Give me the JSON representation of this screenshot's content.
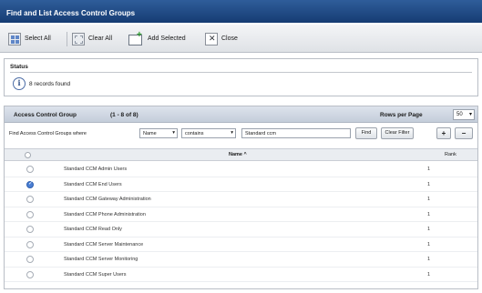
{
  "window": {
    "title": "Find and List Access Control Groups"
  },
  "toolbar": {
    "select_all": "Select All",
    "clear_all": "Clear All",
    "add_selected": "Add Selected",
    "close": "Close"
  },
  "status": {
    "title": "Status",
    "message": "8 records found"
  },
  "panel": {
    "title": "Access Control Group",
    "count": "(1 - 8 of 8)",
    "rows_per_page_label": "Rows per Page",
    "rows_per_page_value": "50"
  },
  "find": {
    "label": "Find Access Control Groups where",
    "field": "Name",
    "operator": "contains",
    "value": "Standard ccm",
    "find_button": "Find",
    "clear_filter_button": "Clear Filter",
    "add_icon": "plus-icon",
    "remove_icon": "minus-icon"
  },
  "table": {
    "columns": {
      "name": "Name ^",
      "rank": "Rank"
    },
    "rows": [
      {
        "name": "Standard CCM Admin Users",
        "rank": "1",
        "checked": false
      },
      {
        "name": "Standard CCM End Users",
        "rank": "1",
        "checked": true
      },
      {
        "name": "Standard CCM Gateway Administration",
        "rank": "1",
        "checked": false
      },
      {
        "name": "Standard CCM Phone Administration",
        "rank": "1",
        "checked": false
      },
      {
        "name": "Standard CCM Read Only",
        "rank": "1",
        "checked": false
      },
      {
        "name": "Standard CCM Server Maintenance",
        "rank": "1",
        "checked": false
      },
      {
        "name": "Standard CCM Server Monitoring",
        "rank": "1",
        "checked": false
      },
      {
        "name": "Standard CCM Super Users",
        "rank": "1",
        "checked": false
      }
    ]
  },
  "colors": {
    "title_bar": "#1f4a86",
    "selected_checkbox": "#4a7fd4"
  }
}
